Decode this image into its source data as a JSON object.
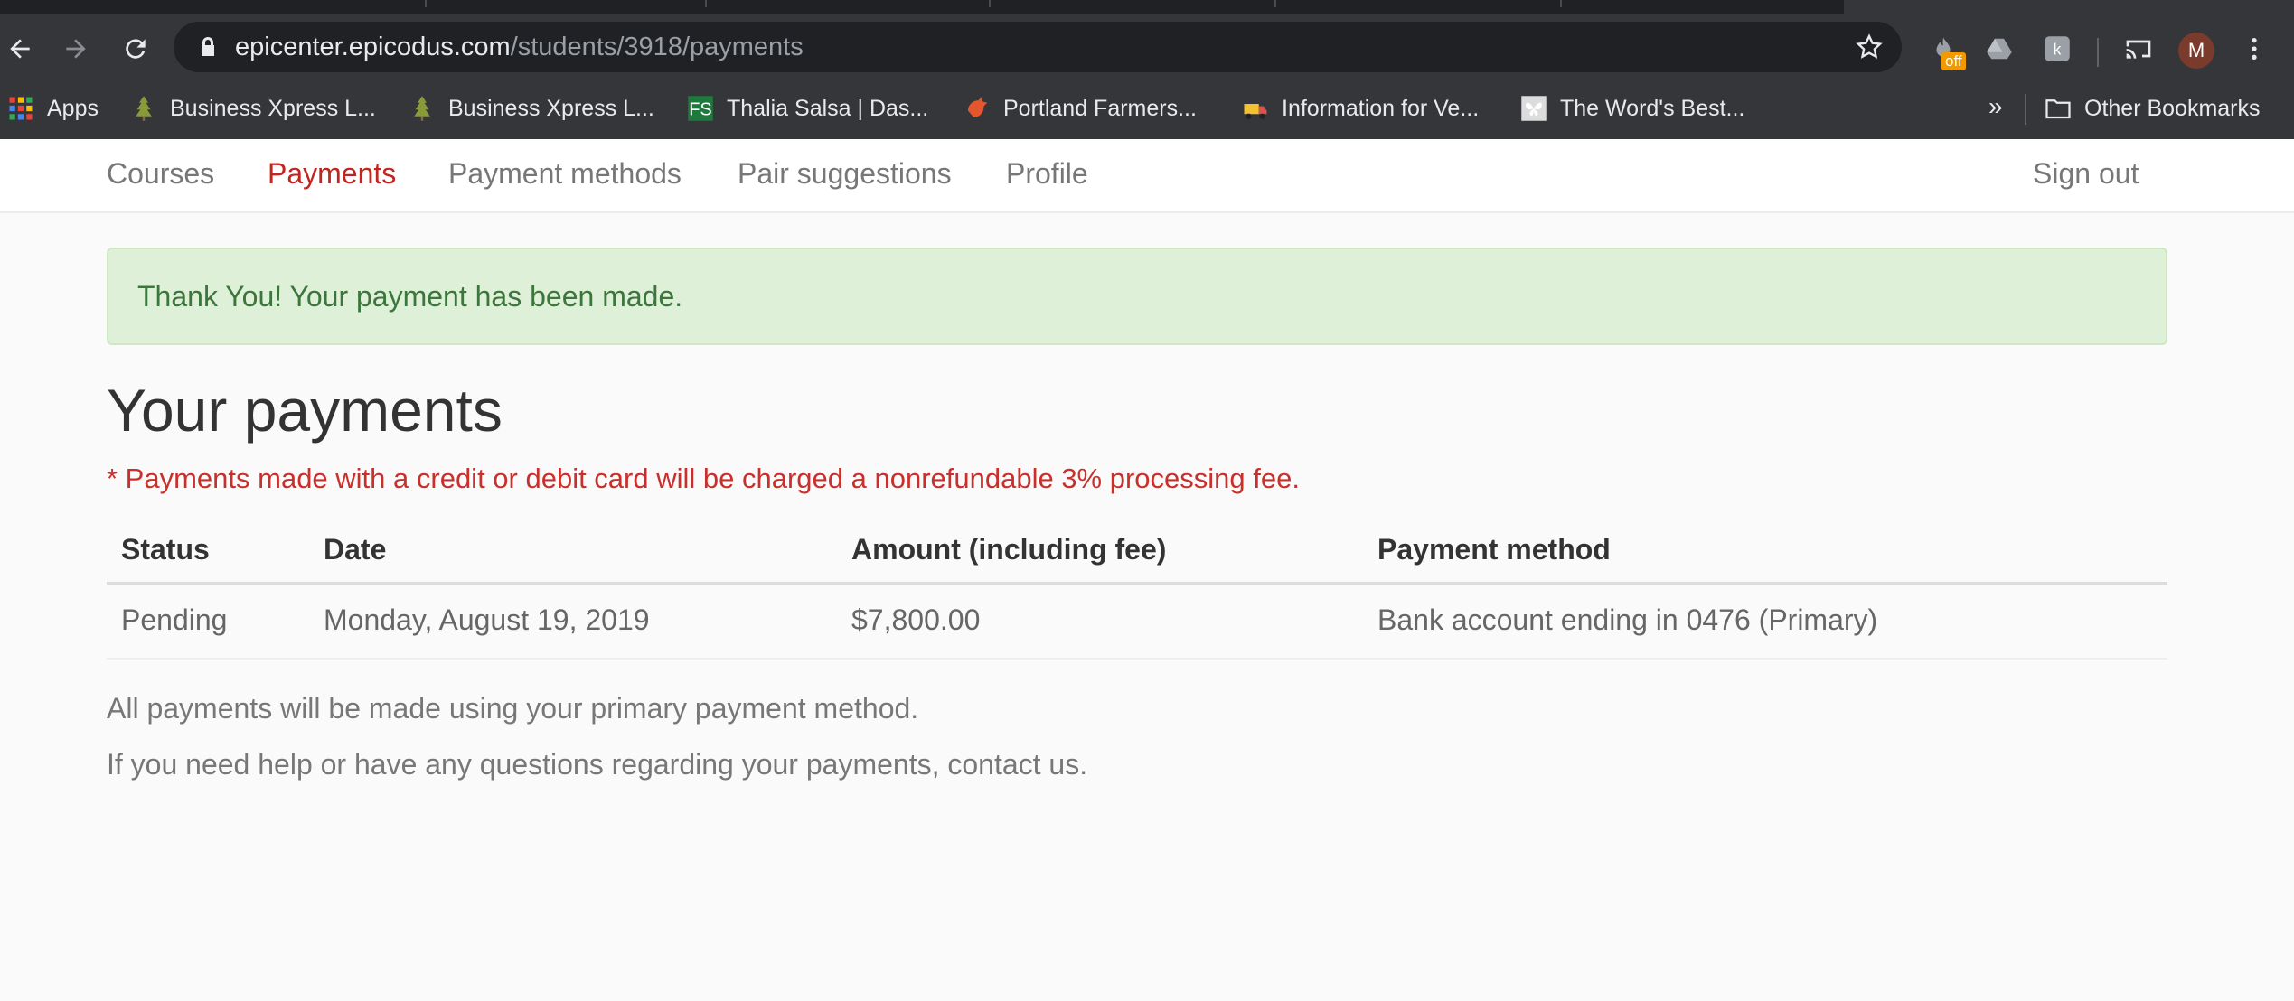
{
  "browser": {
    "url_host": "epicenter.epicodus.com",
    "url_path": "/students/3918/payments",
    "extension_badge": "off",
    "avatar_letter": "M",
    "bookmarks": [
      {
        "label": "Apps",
        "icon": "apps-grid-icon"
      },
      {
        "label": "Business Xpress L...",
        "icon": "tree-icon"
      },
      {
        "label": "Business Xpress L...",
        "icon": "tree-icon"
      },
      {
        "label": "Thalia Salsa | Das...",
        "icon": "fs-logo-icon"
      },
      {
        "label": "Portland Farmers...",
        "icon": "rooster-icon"
      },
      {
        "label": "Information for Ve...",
        "icon": "truck-icon"
      },
      {
        "label": "The Word's Best...",
        "icon": "butterfly-icon"
      }
    ],
    "bookmarks_overflow": "»",
    "other_bookmarks": "Other Bookmarks"
  },
  "nav": {
    "items": [
      "Courses",
      "Payments",
      "Payment methods",
      "Pair suggestions",
      "Profile"
    ],
    "active": "Payments",
    "sign_out": "Sign out"
  },
  "alert": {
    "message": "Thank You! Your payment has been made.",
    "color": "#3c763d"
  },
  "main": {
    "title": "Your payments",
    "fee_note": "* Payments made with a credit or debit card will be charged a nonrefundable 3% processing fee.",
    "table": {
      "headers": [
        "Status",
        "Date",
        "Amount (including fee)",
        "Payment method"
      ],
      "rows": [
        [
          "Pending",
          "Monday, August 19, 2019",
          "$7,800.00",
          "Bank account ending in 0476 (Primary)"
        ]
      ]
    },
    "footer_lines": [
      "All payments will be made using your primary payment method.",
      "If you need help or have any questions regarding your payments, contact us."
    ]
  },
  "colors": {
    "accent": "#c0261f",
    "chrome_bg": "#35363a",
    "alert_bg": "#dff0d8"
  }
}
